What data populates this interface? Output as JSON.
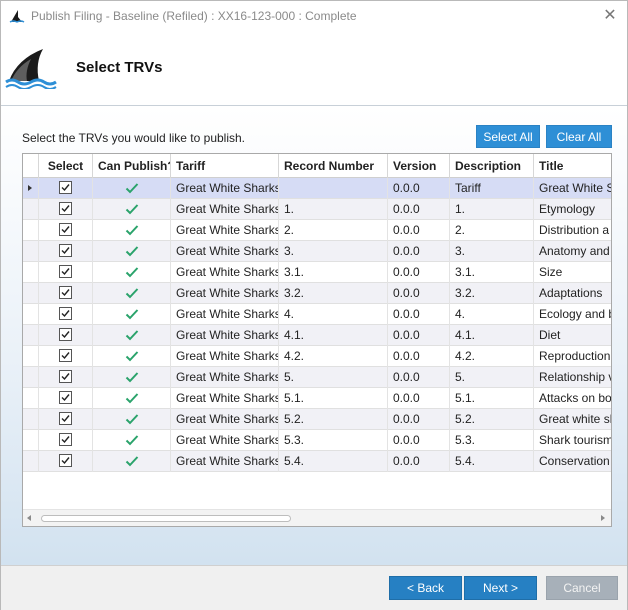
{
  "window": {
    "title": "Publish Filing - Baseline (Refiled) : XX16-123-000 : Complete",
    "close_glyph": "✕"
  },
  "header": {
    "title": "Select TRVs"
  },
  "content": {
    "instruction": "Select the TRVs you would like to publish.",
    "select_all_label": "Select All",
    "clear_all_label": "Clear All"
  },
  "table": {
    "columns": [
      "Select",
      "Can Publish?",
      "Tariff",
      "Record Number",
      "Version",
      "Description",
      "Title"
    ],
    "rows": [
      {
        "select": true,
        "can_publish": true,
        "tariff": "Great White Sharks",
        "record_number": "",
        "version": "0.0.0",
        "description": "Tariff",
        "title": "Great White S"
      },
      {
        "select": true,
        "can_publish": true,
        "tariff": "Great White Sharks",
        "record_number": "1.",
        "version": "0.0.0",
        "description": "1.",
        "title": "Etymology"
      },
      {
        "select": true,
        "can_publish": true,
        "tariff": "Great White Sharks",
        "record_number": "2.",
        "version": "0.0.0",
        "description": "2.",
        "title": "Distribution a"
      },
      {
        "select": true,
        "can_publish": true,
        "tariff": "Great White Sharks",
        "record_number": "3.",
        "version": "0.0.0",
        "description": "3.",
        "title": "Anatomy and"
      },
      {
        "select": true,
        "can_publish": true,
        "tariff": "Great White Sharks",
        "record_number": "3.1.",
        "version": "0.0.0",
        "description": "3.1.",
        "title": "Size"
      },
      {
        "select": true,
        "can_publish": true,
        "tariff": "Great White Sharks",
        "record_number": "3.2.",
        "version": "0.0.0",
        "description": "3.2.",
        "title": "Adaptations"
      },
      {
        "select": true,
        "can_publish": true,
        "tariff": "Great White Sharks",
        "record_number": "4.",
        "version": "0.0.0",
        "description": "4.",
        "title": "Ecology and b"
      },
      {
        "select": true,
        "can_publish": true,
        "tariff": "Great White Sharks",
        "record_number": "4.1.",
        "version": "0.0.0",
        "description": "4.1.",
        "title": "Diet"
      },
      {
        "select": true,
        "can_publish": true,
        "tariff": "Great White Sharks",
        "record_number": "4.2.",
        "version": "0.0.0",
        "description": "4.2.",
        "title": "Reproduction"
      },
      {
        "select": true,
        "can_publish": true,
        "tariff": "Great White Sharks",
        "record_number": "5.",
        "version": "0.0.0",
        "description": "5.",
        "title": "Relationship v"
      },
      {
        "select": true,
        "can_publish": true,
        "tariff": "Great White Sharks",
        "record_number": "5.1.",
        "version": "0.0.0",
        "description": "5.1.",
        "title": "Attacks on bo"
      },
      {
        "select": true,
        "can_publish": true,
        "tariff": "Great White Sharks",
        "record_number": "5.2.",
        "version": "0.0.0",
        "description": "5.2.",
        "title": "Great white sh"
      },
      {
        "select": true,
        "can_publish": true,
        "tariff": "Great White Sharks",
        "record_number": "5.3.",
        "version": "0.0.0",
        "description": "5.3.",
        "title": "Shark tourism"
      },
      {
        "select": true,
        "can_publish": true,
        "tariff": "Great White Sharks",
        "record_number": "5.4.",
        "version": "0.0.0",
        "description": "5.4.",
        "title": "Conservation"
      }
    ]
  },
  "footer": {
    "back_label": "< Back",
    "next_label": "Next >",
    "cancel_label": "Cancel"
  },
  "colors": {
    "accent": "#2e8fd6",
    "check_green": "#2aa36b",
    "selected_row": "#d6dcf5"
  },
  "icons": {
    "app": "shark-fin-icon",
    "logo": "shark-fin-logo-icon",
    "check": "checkmark-icon",
    "checkbox": "checkbox-checked-icon"
  }
}
